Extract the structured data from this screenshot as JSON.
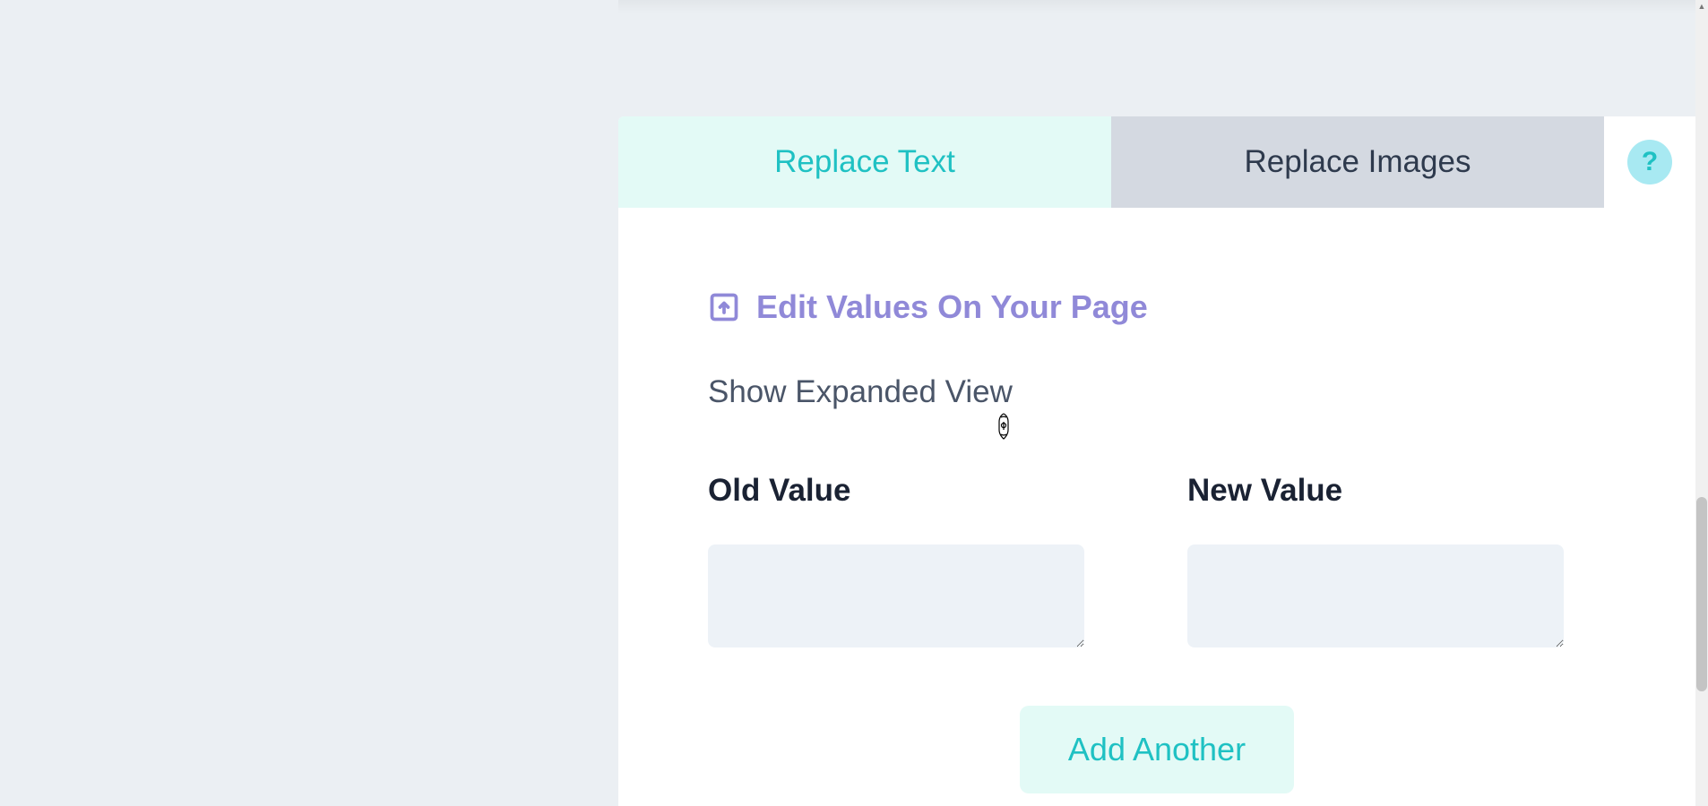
{
  "tabs": {
    "replace_text": "Replace Text",
    "replace_images": "Replace Images"
  },
  "help_icon": "?",
  "edit_values": {
    "label": "Edit Values On Your Page"
  },
  "expanded_view": "Show Expanded View",
  "columns": {
    "old_value": "Old Value",
    "new_value": "New Value"
  },
  "inputs": {
    "old_value": "",
    "new_value": ""
  },
  "buttons": {
    "add_another": "Add Another"
  },
  "colors": {
    "accent": "#1fc1c3",
    "accent_bg": "#e3faf6",
    "link": "#9089d8",
    "text_dark": "#1a2233",
    "text_muted": "#4a5568",
    "input_bg": "#edf2f7",
    "page_bg": "#ebeff3",
    "tab_inactive_bg": "#d4d9e1"
  }
}
